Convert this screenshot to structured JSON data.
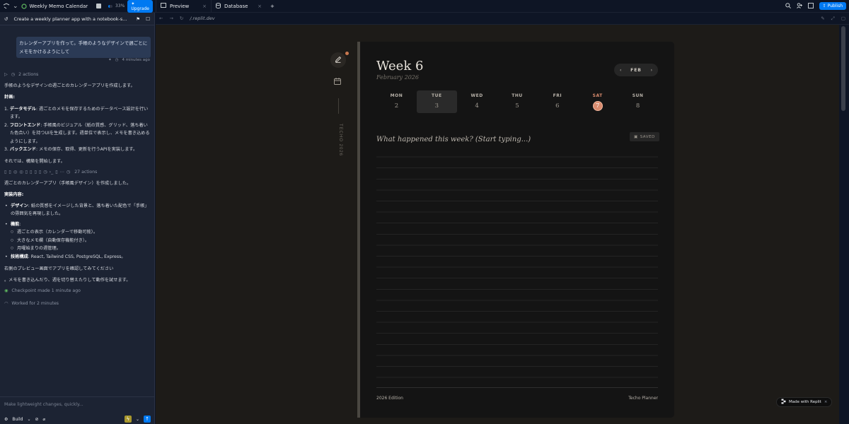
{
  "topbar": {
    "app_title": "Weekly Memo Calendar",
    "progress_percent": 33,
    "progress_label": "33%",
    "upgrade_label": "Upgrade",
    "tabs": [
      {
        "label": "Preview"
      },
      {
        "label": "Database"
      }
    ],
    "publish_label": "Publish"
  },
  "sidebar": {
    "thread_title": "Create a weekly planner app with a notebook-s...",
    "user_message": "カレンダーアプリを作って。手帳のようなデザインで週ごとにメモをかけるようにして",
    "timestamp": "4 minutes ago",
    "actions1": "2 actions",
    "intro": "手帳のようなデザインの週ごとのカレンダーアプリを作成します。",
    "plan_heading": "計画:",
    "plan_items": [
      {
        "num": "1.",
        "title": "データモデル",
        "text": ": 週ごとのメモを保存するためのデータベース設計を行います。"
      },
      {
        "num": "2.",
        "title": "フロントエンド",
        "text": ": 手帳風のビジュアル（紙の質感、グリッド、落ち着いた色合い）を持つUIを生成します。週単位で表示し、メモを書き込めるようにします。"
      },
      {
        "num": "3.",
        "title": "バックエンド",
        "text": ": メモの保存、取得、更新を行うAPIを実装します。"
      }
    ],
    "start": "それでは、構築を開始します。",
    "actions2": "27 actions",
    "done": "週ごとのカレンダーアプリ（手帳風デザイン）を作成しました。",
    "impl_heading": "実装内容:",
    "impl_design_title": "デザイン",
    "impl_design_text": ": 紙の質感をイメージした背景と、落ち着いた配色で「手帳」の雰囲気を再現しました。",
    "impl_features_title": "機能",
    "impl_features": [
      "週ごとの表示（カレンダーで移動可能）。",
      "大きなメモ欄（自動保存機能付き）。",
      "月曜始まりの週管理。"
    ],
    "impl_tech_title": "技術構成",
    "impl_tech_text": ": React, Tailwind CSS, PostgreSQL, Express。",
    "confirm": "右側のプレビュー画面でアプリを確認してみてください",
    "confirm2": "。メモを書き込んだり、週を切り替えたりして動作を試せます。",
    "checkpoint": "Checkpoint made 1 minute ago",
    "worked": "Worked for 2 minutes",
    "input_placeholder": "Make lightweight changes, quickly...",
    "mode_label": "Build"
  },
  "urlbar": {
    "url": "/.replit.dev"
  },
  "planner": {
    "side_text": "TECHO 2026",
    "week_title": "Week 6",
    "month_year": "February 2026",
    "month_short": "FEB",
    "days": [
      {
        "name": "MON",
        "date": "2"
      },
      {
        "name": "TUE",
        "date": "3"
      },
      {
        "name": "WED",
        "date": "4"
      },
      {
        "name": "THU",
        "date": "5"
      },
      {
        "name": "FRI",
        "date": "6"
      },
      {
        "name": "SAT",
        "date": "7"
      },
      {
        "name": "SUN",
        "date": "8"
      }
    ],
    "memo_placeholder": "What happened this week? (Start typing...)",
    "saved_label": "SAVED",
    "footer_left": "2026 Edition",
    "footer_right": "Techo Planner"
  },
  "badge": {
    "label": "Made with Replit"
  },
  "colors": {
    "accent": "#0079f2",
    "today": "#d98b6e",
    "page": "#141414",
    "preview_bg": "#1d1b18"
  }
}
